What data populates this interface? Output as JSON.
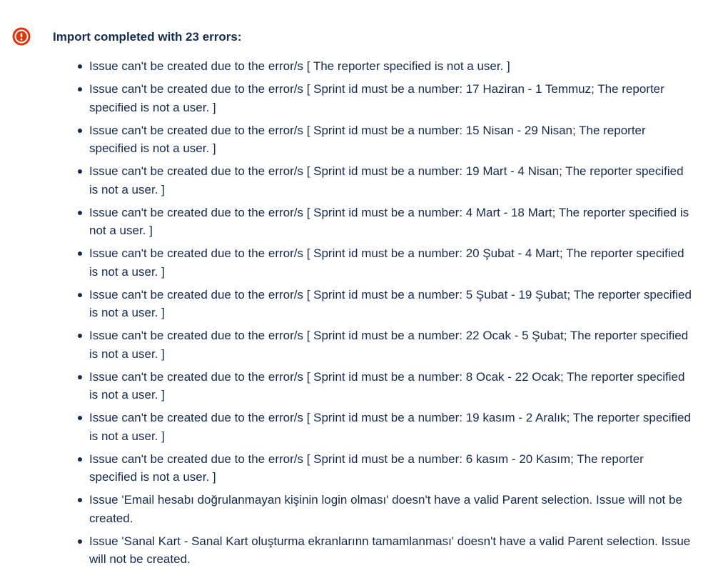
{
  "icon": "error-circle-icon",
  "colors": {
    "error_red": "#de350b",
    "text": "#172b4d"
  },
  "title": "Import completed with 23 errors:",
  "errors": [
    "Issue can't be created due to the error/s [ The reporter specified is not a user. ]",
    "Issue can't be created due to the error/s [ Sprint id must be a number: 17 Haziran - 1 Temmuz; The reporter specified is not a user. ]",
    "Issue can't be created due to the error/s [ Sprint id must be a number: 15 Nisan - 29 Nisan; The reporter specified is not a user. ]",
    "Issue can't be created due to the error/s [ Sprint id must be a number: 19 Mart - 4 Nisan; The reporter specified is not a user. ]",
    "Issue can't be created due to the error/s [ Sprint id must be a number: 4 Mart - 18 Mart; The reporter specified is not a user. ]",
    "Issue can't be created due to the error/s [ Sprint id must be a number: 20 Şubat - 4 Mart; The reporter specified is not a user. ]",
    "Issue can't be created due to the error/s [ Sprint id must be a number: 5 Şubat - 19 Şubat; The reporter specified is not a user. ]",
    "Issue can't be created due to the error/s [ Sprint id must be a number: 22 Ocak - 5 Şubat; The reporter specified is not a user. ]",
    "Issue can't be created due to the error/s [ Sprint id must be a number: 8 Ocak - 22 Ocak; The reporter specified is not a user. ]",
    "Issue can't be created due to the error/s [ Sprint id must be a number: 19 kasım - 2 Aralık; The reporter specified is not a user. ]",
    "Issue can't be created due to the error/s [ Sprint id must be a number: 6 kasım - 20 Kasım; The reporter specified is not a user. ]",
    "Issue 'Email hesabı doğrulanmayan kişinin login olması' doesn't have a valid Parent selection. Issue will not be created.",
    "Issue 'Sanal Kart - Sanal Kart oluşturma ekranlarınn tamamlanması' doesn't have a valid Parent selection. Issue will not be created."
  ]
}
